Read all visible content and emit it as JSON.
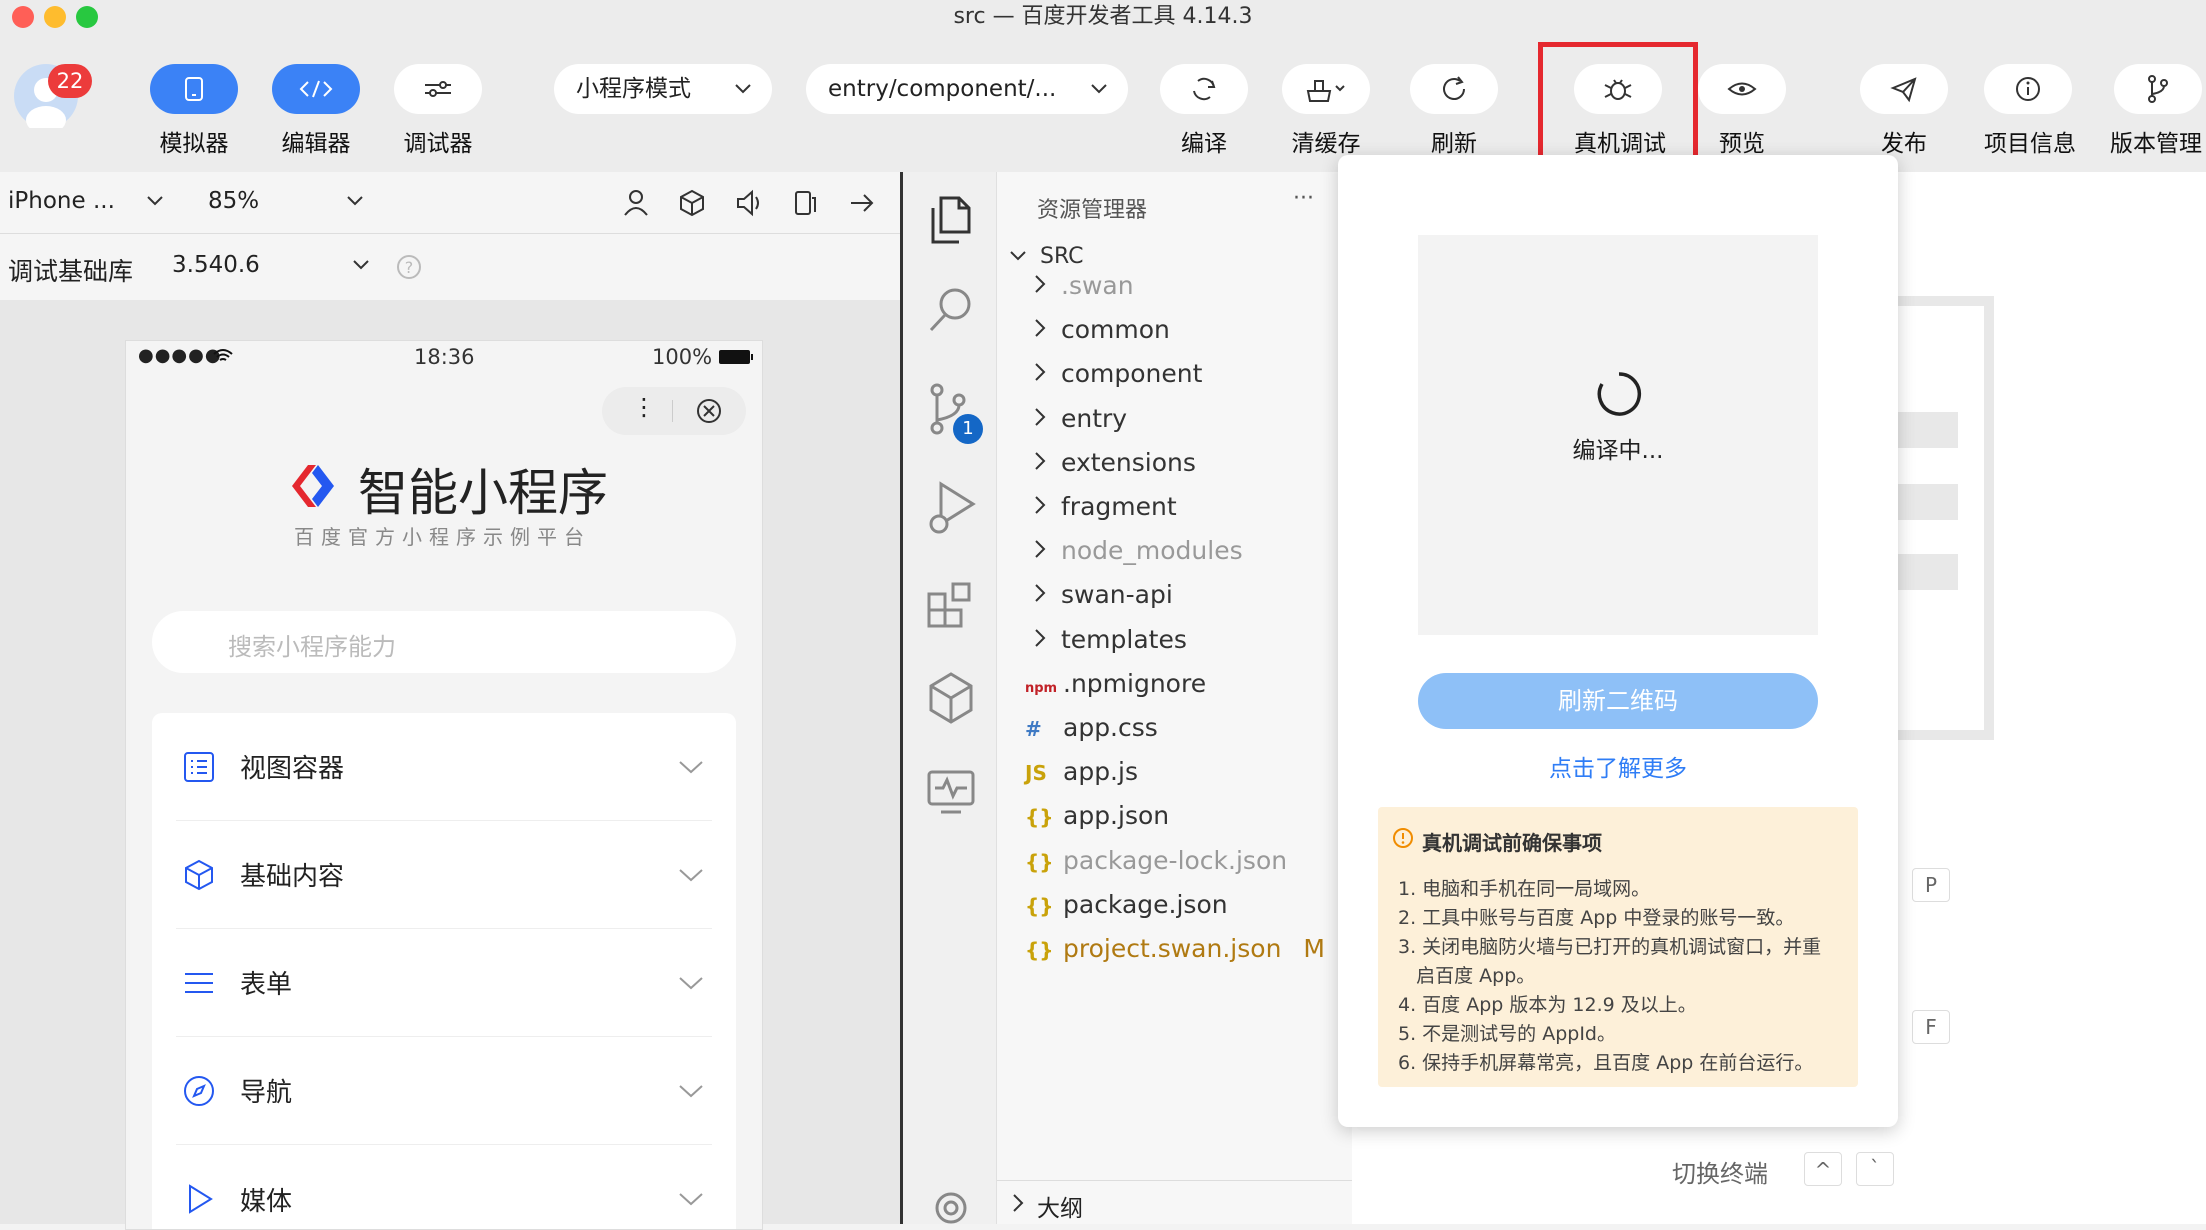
{
  "window": {
    "title": "src — 百度开发者工具 4.14.3"
  },
  "toolbar": {
    "avatar_badge": "22",
    "simulator": "模拟器",
    "editor": "编辑器",
    "debugger": "调试器",
    "mode_select": "小程序模式",
    "page_select": "entry/component/...",
    "compile": "编译",
    "clear_cache": "清缓存",
    "refresh": "刷新",
    "real_debug": "真机调试",
    "preview": "预览",
    "publish": "发布",
    "project_info": "项目信息",
    "version_mgmt": "版本管理"
  },
  "simulator": {
    "device": "iPhone ...",
    "zoom": "85%",
    "lib_label": "调试基础库",
    "lib_version": "3.540.6"
  },
  "phone": {
    "signal": "●●●●●",
    "time": "18:36",
    "battery": "100%",
    "app_title": "智能小程序",
    "app_subtitle": "百度官方小程序示例平台",
    "search_placeholder": "搜索小程序能力",
    "items": [
      {
        "label": "视图容器",
        "icon": "list-icon"
      },
      {
        "label": "基础内容",
        "icon": "cube-icon"
      },
      {
        "label": "表单",
        "icon": "menu-icon"
      },
      {
        "label": "导航",
        "icon": "compass-icon"
      },
      {
        "label": "媒体",
        "icon": "play-icon"
      }
    ]
  },
  "explorer": {
    "title": "资源管理器",
    "more": "···",
    "root": "SRC",
    "folders": [
      ".swan",
      "common",
      "component",
      "entry",
      "extensions",
      "fragment",
      "node_modules",
      "swan-api",
      "templates"
    ],
    "files": [
      {
        "name": ".npmignore",
        "icon": "npm",
        "color": "#333"
      },
      {
        "name": "app.css",
        "icon": "#",
        "color": "#333"
      },
      {
        "name": "app.js",
        "icon": "JS",
        "color": "#333"
      },
      {
        "name": "app.json",
        "icon": "{}",
        "color": "#333"
      },
      {
        "name": "package-lock.json",
        "icon": "{}",
        "color": "#999"
      },
      {
        "name": "package.json",
        "icon": "{}",
        "color": "#333"
      },
      {
        "name": "project.swan.json",
        "icon": "{}",
        "color": "#b07a12"
      }
    ],
    "modified_mark": "M",
    "outline": "大纲",
    "git_badge": "1"
  },
  "popup": {
    "compiling": "编译中...",
    "refresh_qr": "刷新二维码",
    "learn_more": "点击了解更多",
    "notice_title": "真机调试前确保事项",
    "notices": [
      "1. 电脑和手机在同一局域网。",
      "2. 工具中账号与百度 App 中登录的账号一致。",
      "3. 关闭电脑防火墙与已打开的真机调试窗口，并重",
      "   启百度 App。",
      "4. 百度 App 版本为 12.9 及以上。",
      "5. 不是测试号的 AppId。",
      "6. 保持手机屏幕常亮，且百度 App 在前台运行。"
    ]
  },
  "right": {
    "switch_terminal": "切换终端",
    "key_p": "P",
    "key_f": "F",
    "key_up": "^",
    "key_backtick": "`"
  },
  "colors": {
    "accent": "#3b82f6",
    "highlight": "#e5282f",
    "notice_bg": "#fdf0d9"
  }
}
